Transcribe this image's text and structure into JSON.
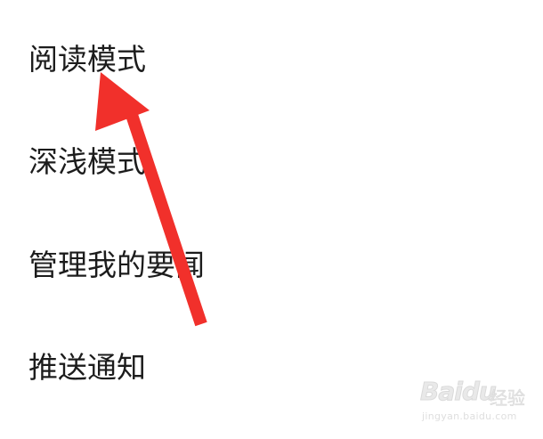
{
  "menu": {
    "items": [
      {
        "label": "阅读模式"
      },
      {
        "label": "深浅模式"
      },
      {
        "label": "管理我的要闻"
      },
      {
        "label": "推送通知"
      }
    ]
  },
  "annotation": {
    "arrow_color": "#f1302b",
    "target": "阅读模式"
  },
  "watermark": {
    "brand": "Baidu",
    "brand_cn": "经验",
    "url": "jingyan.baidu.com"
  }
}
